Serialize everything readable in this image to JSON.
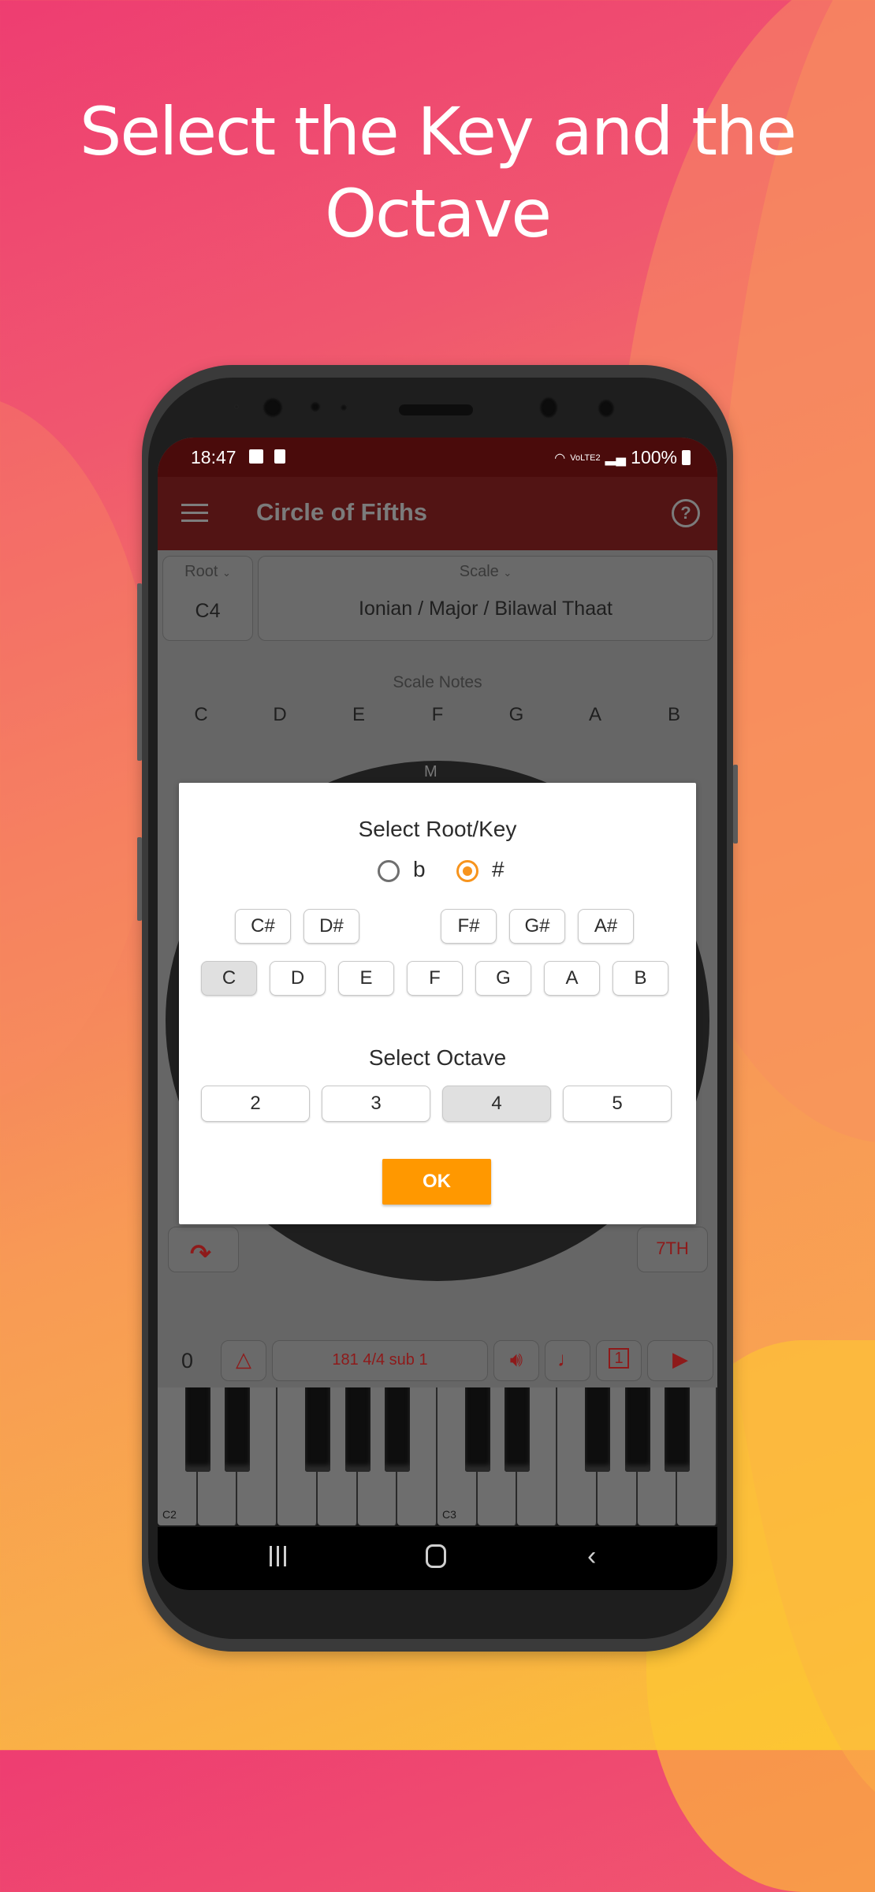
{
  "headline": {
    "line1": "Select the Key and the",
    "line2": "Octave"
  },
  "status_bar": {
    "time": "18:47",
    "left_icons": [
      "gallery-icon",
      "screen-record-icon"
    ],
    "network": "VoLTE2",
    "battery": "100%"
  },
  "app_bar": {
    "title": "Circle of Fifths",
    "menu_icon": "hamburger-menu-icon",
    "help_icon": "help-icon"
  },
  "root_card": {
    "label": "Root",
    "value": "C4"
  },
  "scale_card": {
    "label": "Scale",
    "value": "Ionian / Major / Bilawal Thaat"
  },
  "scale_notes": {
    "label": "Scale Notes",
    "notes": [
      "C",
      "D",
      "E",
      "F",
      "G",
      "A",
      "B"
    ]
  },
  "circle": {
    "top_letter": "M"
  },
  "side_buttons": {
    "redo_icon": "redo-icon",
    "chord_type": "7TH"
  },
  "toolbar": {
    "count": "0",
    "metronome_icon": "metronome-icon",
    "tempo": "181 4/4 sub 1",
    "volume_icon": "volume-icon",
    "guitar_icon": "guitar-icon",
    "loop_icon": "repeat-one-icon",
    "play_icon": "play-icon"
  },
  "piano": {
    "labels": [
      "C2",
      "C3"
    ],
    "white_keys": 14
  },
  "dialog": {
    "title_root": "Select Root/Key",
    "accidentals": [
      {
        "label": "b",
        "selected": false
      },
      {
        "label": "#",
        "selected": true
      }
    ],
    "sharp_keys": [
      "C#",
      "D#",
      "F#",
      "G#",
      "A#"
    ],
    "natural_keys": [
      "C",
      "D",
      "E",
      "F",
      "G",
      "A",
      "B"
    ],
    "selected_key": "C",
    "title_octave": "Select Octave",
    "octaves": [
      "2",
      "3",
      "4",
      "5"
    ],
    "selected_octave": "4",
    "ok_label": "OK",
    "accent_color": "#ff9800"
  }
}
